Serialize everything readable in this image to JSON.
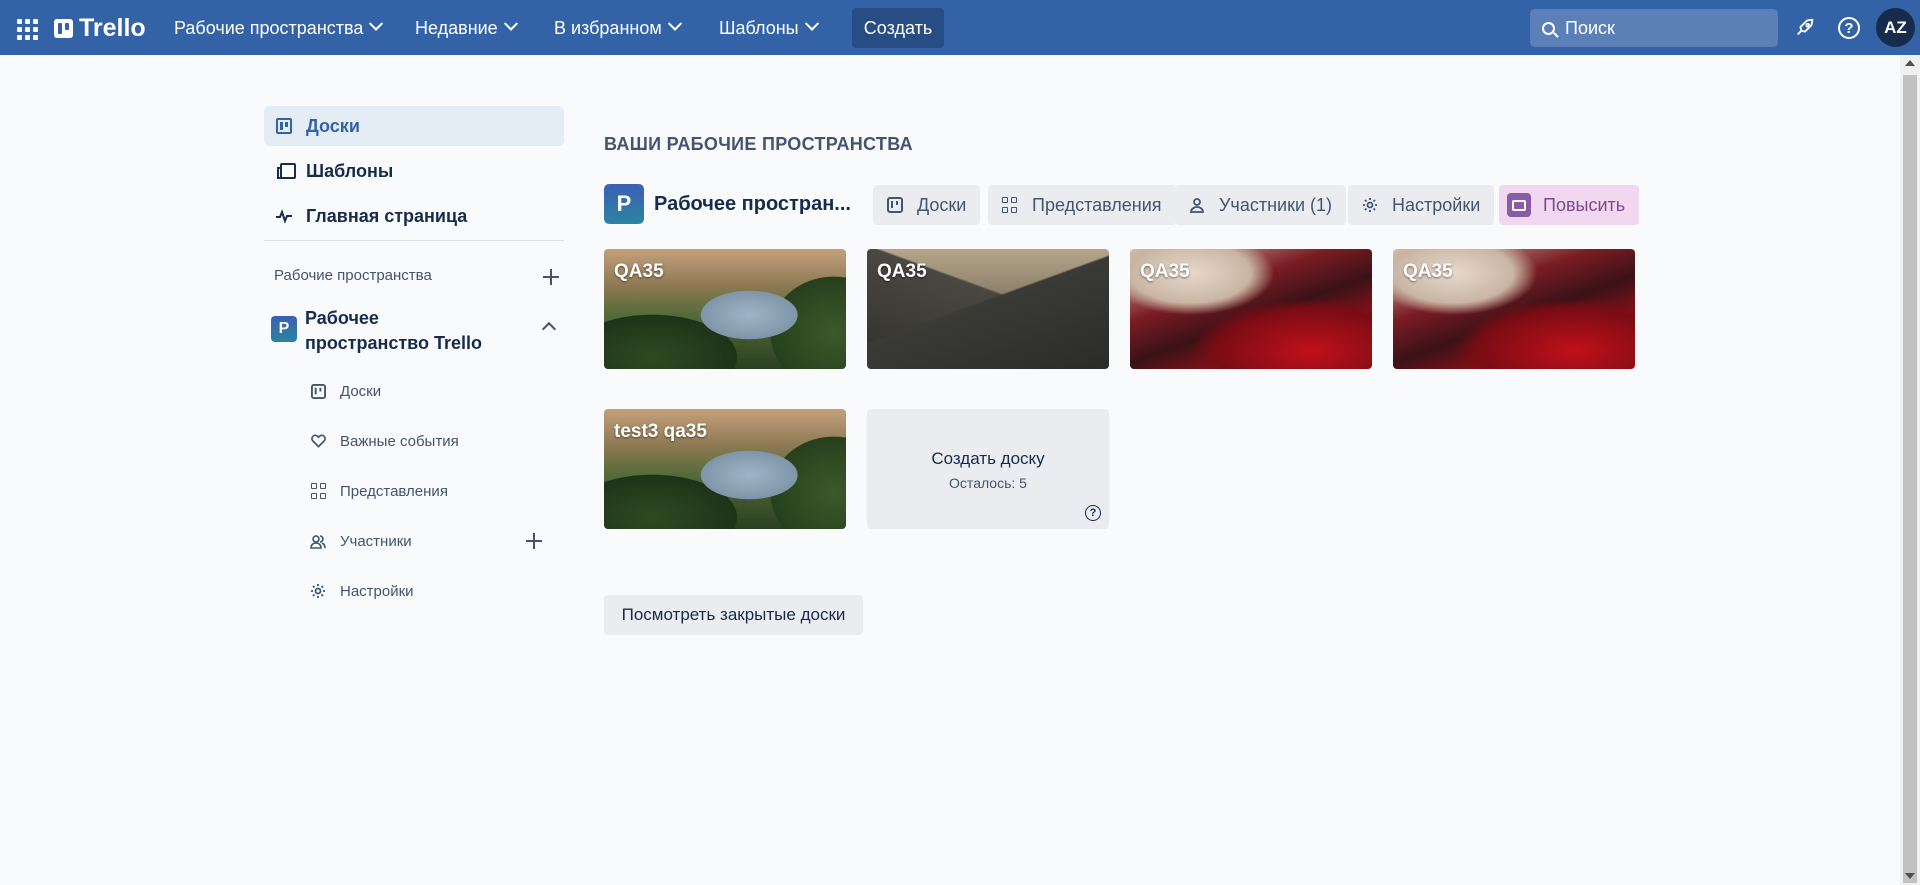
{
  "header": {
    "logo": "Trello",
    "nav": [
      {
        "label": "Рабочие пространства"
      },
      {
        "label": "Недавние"
      },
      {
        "label": "В избранном"
      },
      {
        "label": "Шаблоны"
      }
    ],
    "create_label": "Создать",
    "search_placeholder": "Поиск",
    "avatar_initials": "AZ",
    "accent_color": "#3363a6"
  },
  "sidebar": {
    "items": [
      {
        "label": "Доски",
        "icon": "board-icon",
        "active": true
      },
      {
        "label": "Шаблоны",
        "icon": "template-icon"
      },
      {
        "label": "Главная страница",
        "icon": "pulse-icon"
      }
    ],
    "workspaces_heading": "Рабочие пространства",
    "workspace": {
      "badge": "P",
      "name": "Рабочее пространство Trello",
      "subitems": [
        {
          "label": "Доски",
          "icon": "board-icon"
        },
        {
          "label": "Важные события",
          "icon": "heart-icon"
        },
        {
          "label": "Представления",
          "icon": "grid-icon"
        },
        {
          "label": "Участники",
          "icon": "members-icon"
        },
        {
          "label": "Настройки",
          "icon": "gear-icon"
        }
      ]
    }
  },
  "main": {
    "title": "ВАШИ РАБОЧИЕ ПРОСТРАНСТВА",
    "workspace_badge": "P",
    "workspace_title": "Рабочее простран...",
    "tabs": [
      {
        "label": "Доски",
        "icon": "board-icon"
      },
      {
        "label": "Представления",
        "icon": "grid-icon"
      },
      {
        "label": "Участники (1)",
        "icon": "person-icon"
      },
      {
        "label": "Настройки",
        "icon": "gear-icon"
      },
      {
        "label": "Повысить",
        "icon": "briefcase-icon"
      }
    ],
    "boards": [
      {
        "title": "QA35",
        "background": "coast"
      },
      {
        "title": "QA35",
        "background": "mountain"
      },
      {
        "title": "QA35",
        "background": "red-waves"
      },
      {
        "title": "QA35",
        "background": "red-waves"
      },
      {
        "title": "test3 qa35",
        "background": "coast"
      }
    ],
    "create_board": {
      "label": "Создать доску",
      "remaining": "Осталось: 5"
    },
    "closed_boards_label": "Посмотреть закрытые доски"
  }
}
